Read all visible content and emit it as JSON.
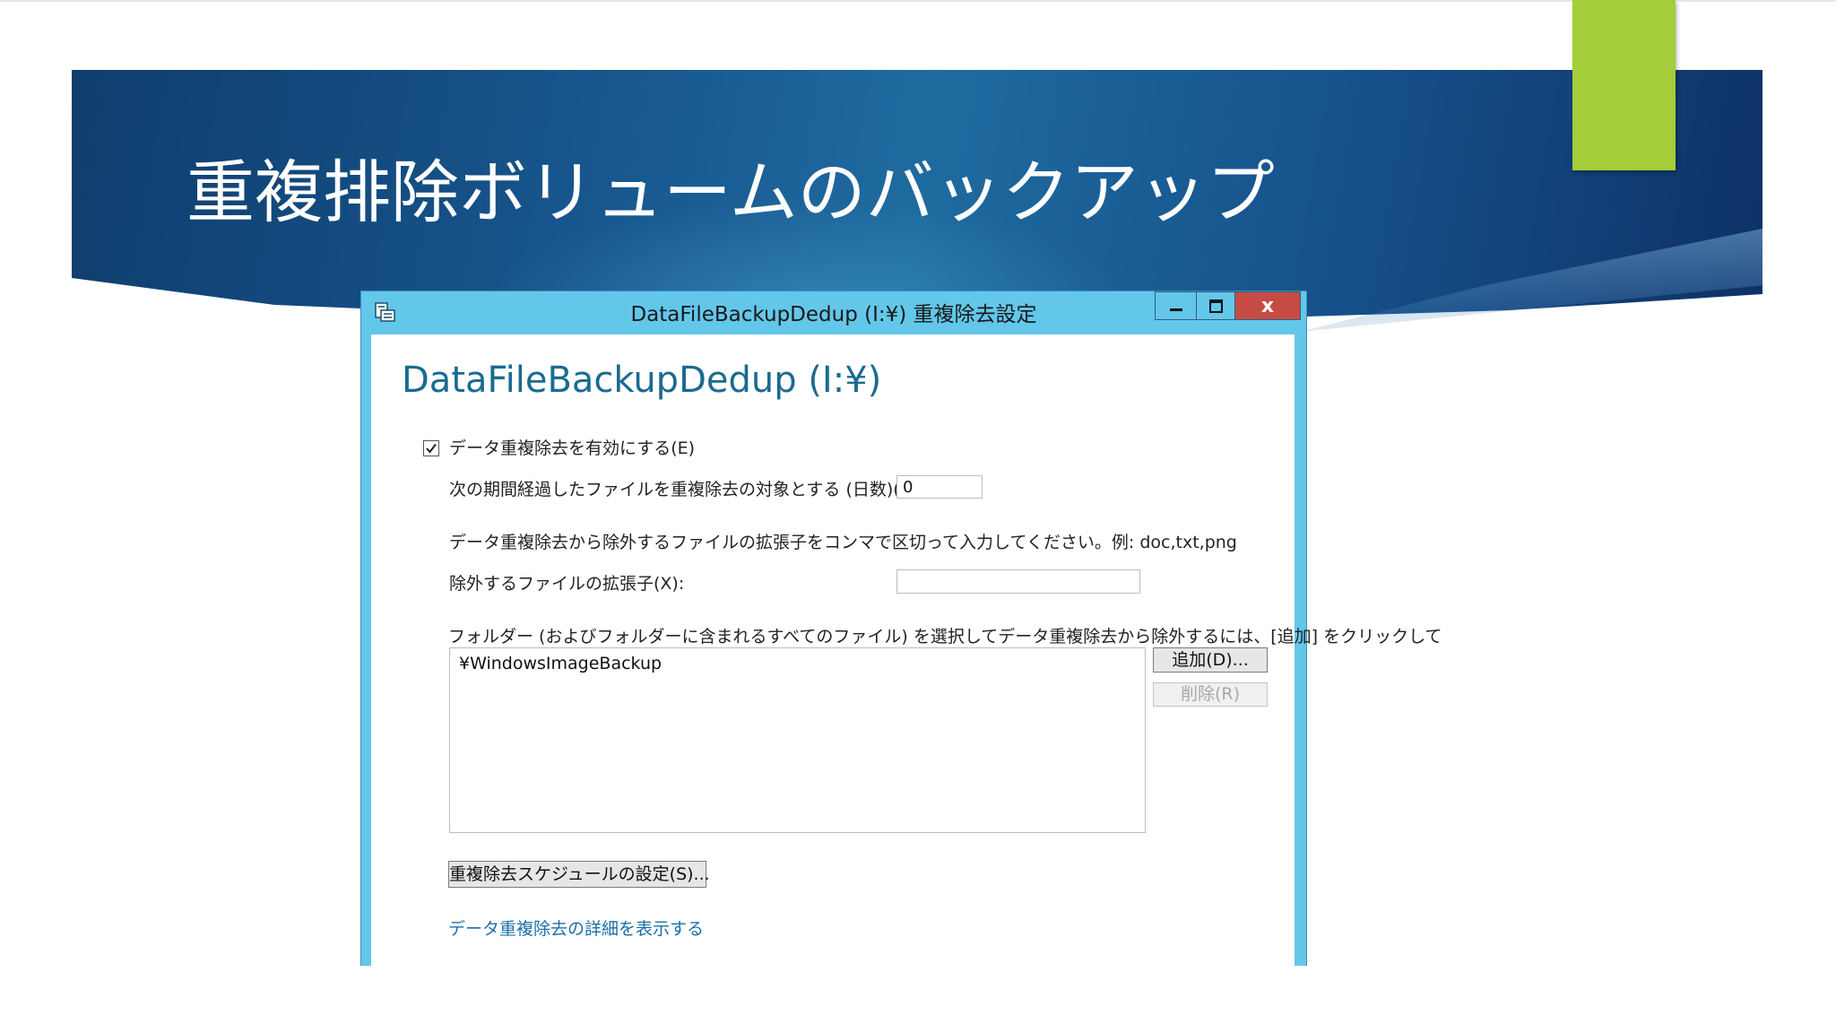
{
  "slide": {
    "title": "重複排除ボリュームのバックアップ"
  },
  "window": {
    "title": "DataFileBackupDedup (I:¥) 重複除去設定",
    "controls": {
      "minimize": "",
      "maximize": "",
      "close": "x"
    }
  },
  "dialog": {
    "heading": "DataFileBackupDedup (I:¥)",
    "enable_checkbox": {
      "label": "データ重複除去を有効にする(E)",
      "checked": true
    },
    "age_label": "次の期間経過したファイルを重複除去の対象とする (日数)(O):",
    "age_value": "0",
    "extensions_instruction": "データ重複除去から除外するファイルの拡張子をコンマで区切って入力してください。例: doc,txt,png",
    "extensions_label": "除外するファイルの拡張子(X):",
    "extensions_value": "",
    "folders_instruction": "フォルダー (およびフォルダーに含まれるすべてのファイル) を選択してデータ重複除去から除外するには、[追加] をクリックして",
    "excluded_folders": [
      "¥WindowsImageBackup"
    ],
    "add_button": "追加(D)...",
    "remove_button": "削除(R)",
    "schedule_button": "重複除去スケジュールの設定(S)...",
    "details_link": "データ重複除去の詳細を表示する"
  },
  "colors": {
    "banner": "#17558c",
    "accent_tab": "#a4cd39",
    "window_frame": "#63c7ea",
    "close_button": "#c74b45",
    "heading": "#1a6b91",
    "link": "#1a6fa8"
  }
}
